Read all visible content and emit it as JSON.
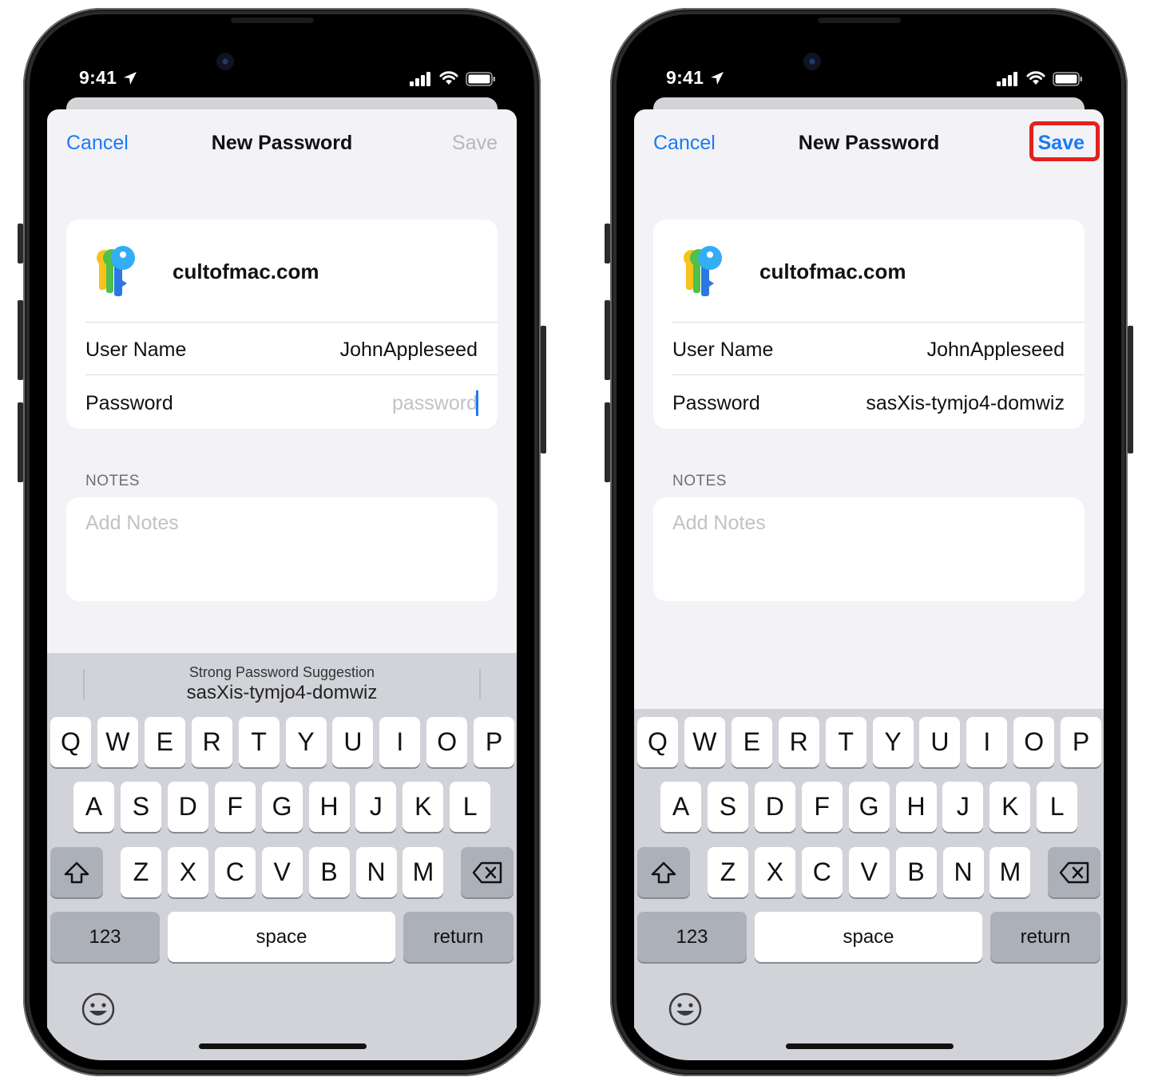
{
  "phones": [
    {
      "status": {
        "time": "9:41"
      },
      "nav": {
        "cancel": "Cancel",
        "title": "New Password",
        "save": "Save"
      },
      "card": {
        "site": "cultofmac.com",
        "username_label": "User Name",
        "username_value": "JohnAppleseed",
        "password_label": "Password",
        "password_placeholder": "password"
      },
      "notes": {
        "header": "NOTES",
        "placeholder": "Add Notes"
      },
      "suggestion": {
        "title": "Strong Password Suggestion",
        "password": "sasXis-tymjo4-domwiz"
      },
      "keyboard": {
        "key_123": "123",
        "key_space": "space",
        "key_return": "return"
      }
    },
    {
      "status": {
        "time": "9:41"
      },
      "nav": {
        "cancel": "Cancel",
        "title": "New Password",
        "save": "Save"
      },
      "card": {
        "site": "cultofmac.com",
        "username_label": "User Name",
        "username_value": "JohnAppleseed",
        "password_label": "Password",
        "password_value": "sasXis-tymjo4-domwiz"
      },
      "notes": {
        "header": "NOTES",
        "placeholder": "Add Notes"
      },
      "keyboard": {
        "key_123": "123",
        "key_space": "space",
        "key_return": "return"
      }
    }
  ],
  "keyboard_rows": {
    "row1": [
      "Q",
      "W",
      "E",
      "R",
      "T",
      "Y",
      "U",
      "I",
      "O",
      "P"
    ],
    "row2": [
      "A",
      "S",
      "D",
      "F",
      "G",
      "H",
      "J",
      "K",
      "L"
    ],
    "row3": [
      "Z",
      "X",
      "C",
      "V",
      "B",
      "N",
      "M"
    ]
  },
  "colors": {
    "accent": "#1a7af5",
    "highlight": "#e4211c",
    "sheet_bg": "#f2f2f7",
    "keyboard_bg": "#d1d3d9"
  }
}
